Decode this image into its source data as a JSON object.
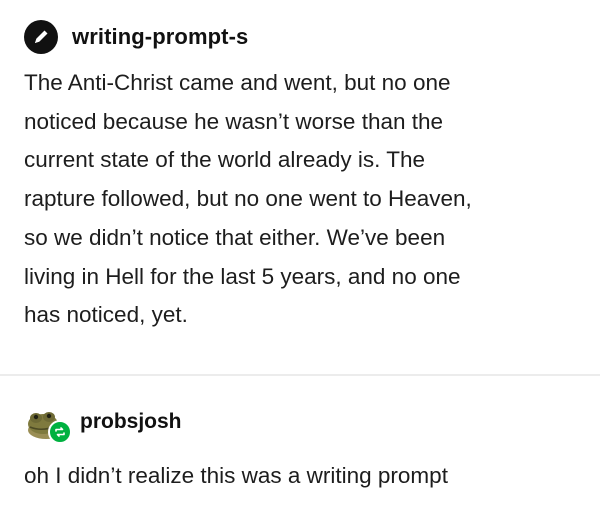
{
  "post": {
    "author": "writing-prompt-s",
    "author_icon": "pencil-icon",
    "body_lines": [
      "The Anti-Christ came and went, but no one",
      "noticed because he wasn’t worse than the",
      "current state of the world already is. The",
      "rapture followed, but no one went to Heaven,",
      "so we didn’t notice that either. We’ve been",
      "living in Hell for the last 5 years, and no one",
      "has noticed, yet."
    ]
  },
  "reply": {
    "author": "probsjosh",
    "avatar_icon": "frog-avatar-icon",
    "badge_icon": "reblog-icon",
    "text": "oh I didn’t realize this was a writing prompt"
  },
  "colors": {
    "text": "#1d1d1d",
    "divider": "#ececec",
    "reblog_badge": "#00b140"
  }
}
